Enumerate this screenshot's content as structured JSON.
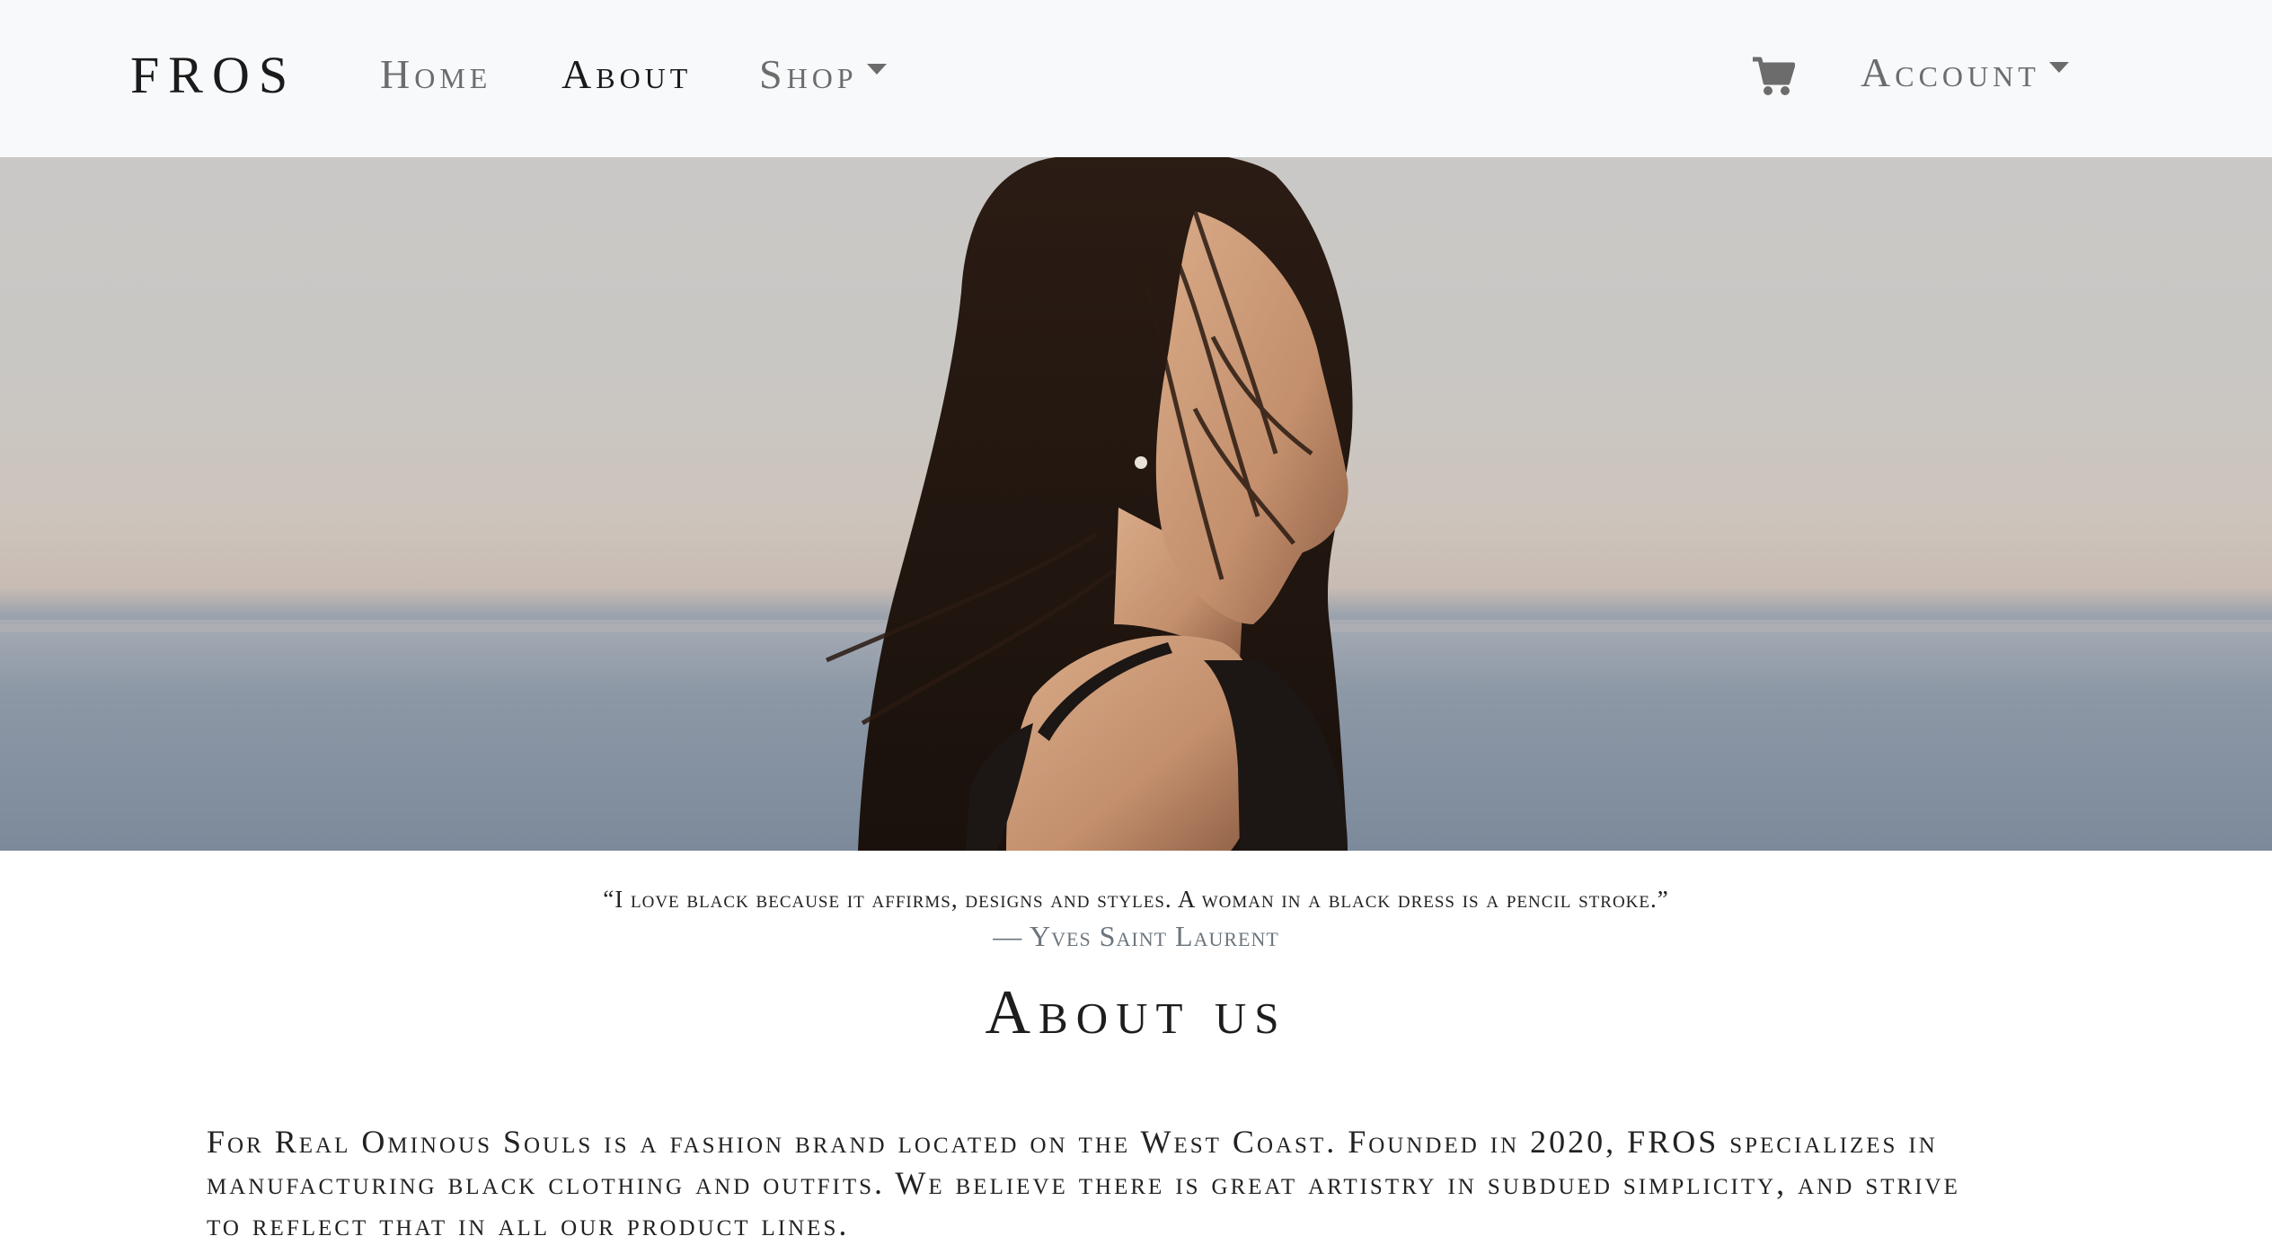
{
  "navbar": {
    "brand": "FROS",
    "items": [
      {
        "label": "Home",
        "active": false
      },
      {
        "label": "About",
        "active": true
      },
      {
        "label": "Shop",
        "dropdown": true
      }
    ],
    "cart_icon": "shopping-cart-icon",
    "account": {
      "label": "Account",
      "dropdown": true
    }
  },
  "hero": {
    "image": "woman-with-dark-hair-by-the-sea"
  },
  "quote": {
    "text": "“I love black because it affirms, designs and styles. A woman in a black dress is a pencil stroke.”",
    "author": "— Yves Saint Laurent"
  },
  "about": {
    "title": "About us",
    "body": "For Real Ominous Souls is a fashion brand located on the West Coast. Founded in 2020, FROS specializes in manufacturing black clothing and outfits. We believe there is great artistry in subdued simplicity, and strive to reflect that in all our product lines."
  },
  "colors": {
    "navbar_bg": "#f8f9fb",
    "nav_text": "#6c6c6c",
    "nav_active": "#1a1a1a",
    "muted_text": "#6c757d"
  }
}
